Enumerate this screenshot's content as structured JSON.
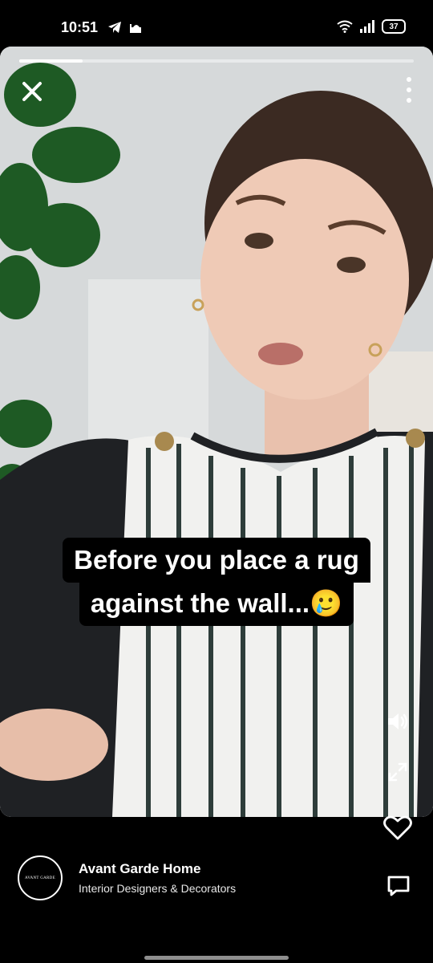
{
  "status_bar": {
    "time": "10:51",
    "battery": "37"
  },
  "story": {
    "progress_fraction": 0.16,
    "caption_line_1": "Before you place a rug",
    "caption_line_2": "against the wall...",
    "caption_emoji": "🥲"
  },
  "profile": {
    "name": "Avant Garde Home",
    "subtitle": "Interior Designers & Decorators",
    "avatar_text": "AVANT GARDE"
  },
  "icons": {
    "close": "close-icon",
    "more": "more-vertical-icon",
    "volume": "volume-icon",
    "expand": "expand-icon",
    "like": "heart-icon",
    "comment": "comment-icon"
  }
}
